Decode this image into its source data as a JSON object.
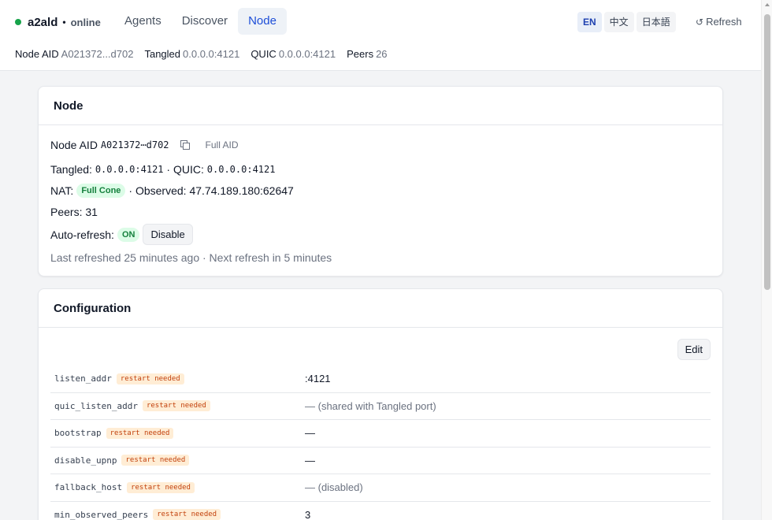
{
  "header": {
    "brand": "a2ald",
    "separator": "•",
    "status": "online",
    "nav": [
      {
        "label": "Agents"
      },
      {
        "label": "Discover"
      },
      {
        "label": "Node"
      }
    ],
    "languages": [
      {
        "label": "EN"
      },
      {
        "label": "中文"
      },
      {
        "label": "日本語"
      }
    ],
    "refresh_icon": "↺",
    "refresh_label": "Refresh",
    "status_color": "#16a34a"
  },
  "infobar": [
    {
      "key": "Node AID",
      "value": "A021372...d702"
    },
    {
      "key": "Tangled",
      "value": "0.0.0.0:4121"
    },
    {
      "key": "QUIC",
      "value": "0.0.0.0:4121"
    },
    {
      "key": "Peers",
      "value": "26"
    }
  ],
  "node_card": {
    "title": "Node",
    "node_aid_label": "Node AID",
    "node_aid_value": "A021372⋯d702",
    "full_aid_label": "Full AID",
    "tangled_label": "Tangled:",
    "tangled_value": "0.0.0.0:4121",
    "quic_sep": "· QUIC:",
    "quic_value": "0.0.0.0:4121",
    "nat_label": "NAT:",
    "nat_badge": "Full Cone",
    "observed": "· Observed: 47.74.189.180:62647",
    "peers": "Peers: 31",
    "auto_refresh_label": "Auto-refresh:",
    "auto_refresh_badge": "ON",
    "disable_button": "Disable",
    "last_refreshed": "Last refreshed 25 minutes ago · Next refresh in 5 minutes"
  },
  "config_card": {
    "title": "Configuration",
    "edit_button": "Edit",
    "restart_badge": "restart needed",
    "rows": [
      {
        "key": "listen_addr",
        "value": ":4121"
      },
      {
        "key": "quic_listen_addr",
        "value": "— (shared with Tangled port)"
      },
      {
        "key": "bootstrap",
        "value": "—"
      },
      {
        "key": "disable_upnp",
        "value": "—"
      },
      {
        "key": "fallback_host",
        "value": "— (disabled)"
      },
      {
        "key": "min_observed_peers",
        "value": "3"
      }
    ]
  }
}
